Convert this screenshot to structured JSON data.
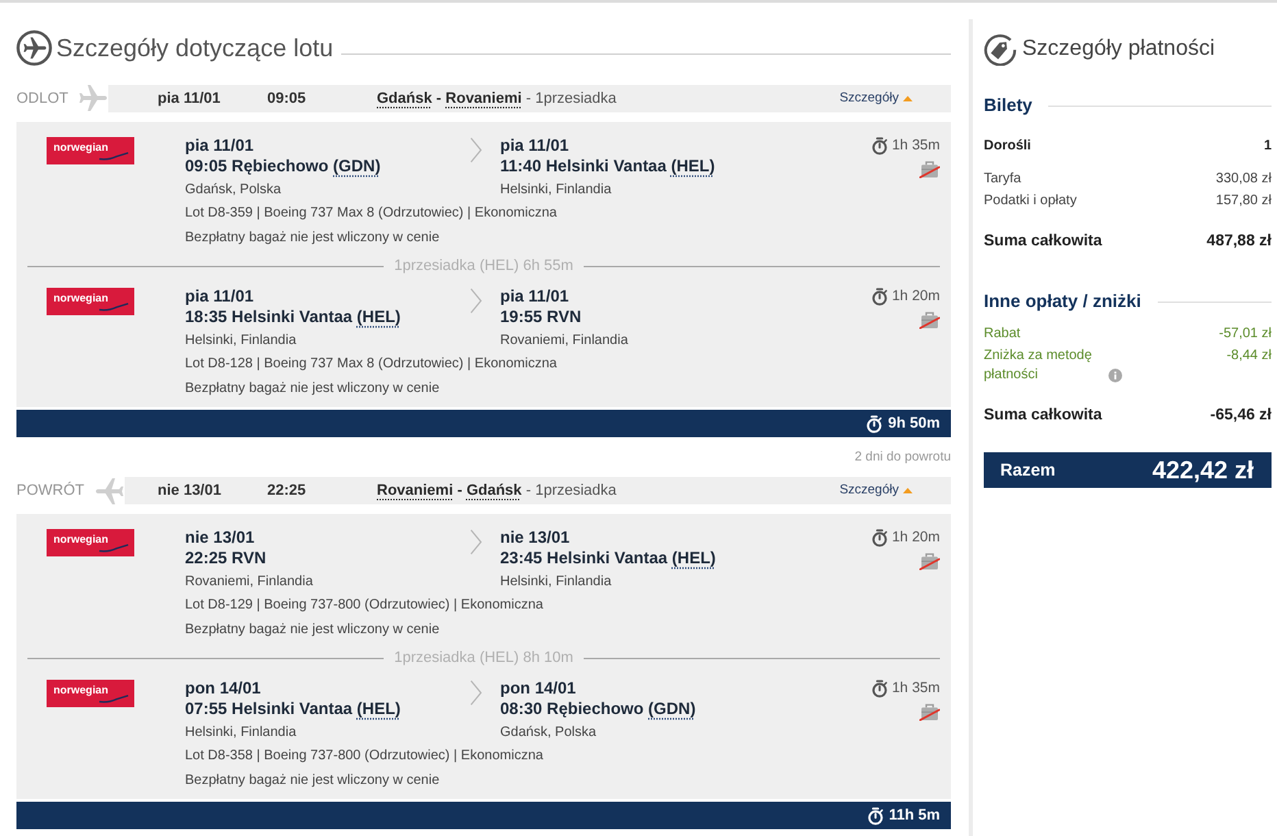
{
  "flight_section": {
    "title": "Szczegóły dotyczące lotu"
  },
  "legs": [
    {
      "label": "ODLOT",
      "kind": "outbound",
      "date": "pia 11/01",
      "time": "09:05",
      "from": "Gdańsk",
      "separator": "-",
      "to": "Rovaniemi",
      "stops": "1przesiadka",
      "details_link": "Szczegóły",
      "expanded": true,
      "rows": [
        {
          "kind": "segment",
          "airline_logo": "norwegian",
          "departure": {
            "date": "pia 11/01",
            "place": "09:05 Rębiechowo",
            "code": "(GDN)",
            "city": "Gdańsk, Polska"
          },
          "arrival": {
            "date": "pia 11/01",
            "place": "11:40 Helsinki Vantaa",
            "code": "(HEL)",
            "city": "Helsinki, Finlandia"
          },
          "duration": "1h 35m",
          "flight_info": "Lot D8-359 | Boeing 737 Max 8 (Odrzutowiec) | Ekonomiczna",
          "baggage_note": "Bezpłatny bagaż nie jest wliczony w cenie",
          "baggage_included": false
        },
        {
          "kind": "layover",
          "text": "1przesiadka (HEL) 6h 55m"
        },
        {
          "kind": "segment",
          "airline_logo": "norwegian",
          "departure": {
            "date": "pia 11/01",
            "place": "18:35 Helsinki Vantaa",
            "code": "(HEL)",
            "city": "Helsinki, Finlandia"
          },
          "arrival": {
            "date": "pia 11/01",
            "place": "19:55 RVN",
            "city": "Rovaniemi, Finlandia"
          },
          "duration": "1h 20m",
          "flight_info": "Lot D8-128 | Boeing 737 Max 8 (Odrzutowiec) | Ekonomiczna",
          "baggage_note": "Bezpłatny bagaż nie jest wliczony w cenie",
          "baggage_included": false
        }
      ],
      "total_duration": "9h 50m"
    },
    {
      "days_between": "2 dni do powrotu",
      "label": "POWRÓT",
      "kind": "return",
      "date": "nie 13/01",
      "time": "22:25",
      "from": "Rovaniemi",
      "separator": "-",
      "to": "Gdańsk",
      "stops": "1przesiadka",
      "details_link": "Szczegóły",
      "expanded": true,
      "rows": [
        {
          "kind": "segment",
          "airline_logo": "norwegian",
          "departure": {
            "date": "nie 13/01",
            "place": "22:25 RVN",
            "city": "Rovaniemi, Finlandia"
          },
          "arrival": {
            "date": "nie 13/01",
            "place": "23:45 Helsinki Vantaa",
            "code": "(HEL)",
            "city": "Helsinki, Finlandia"
          },
          "duration": "1h 20m",
          "flight_info": "Lot D8-129 | Boeing 737-800 (Odrzutowiec) | Ekonomiczna",
          "baggage_note": "Bezpłatny bagaż nie jest wliczony w cenie",
          "baggage_included": false
        },
        {
          "kind": "layover",
          "text": "1przesiadka (HEL) 8h 10m"
        },
        {
          "kind": "segment",
          "airline_logo": "norwegian",
          "departure": {
            "date": "pon 14/01",
            "place": "07:55 Helsinki Vantaa",
            "code": "(HEL)",
            "city": "Helsinki, Finlandia"
          },
          "arrival": {
            "date": "pon 14/01",
            "place": "08:30 Rębiechowo",
            "code": "(GDN)",
            "city": "Gdańsk, Polska"
          },
          "duration": "1h 35m",
          "flight_info": "Lot D8-358 | Boeing 737-800 (Odrzutowiec) | Ekonomiczna",
          "baggage_note": "Bezpłatny bagaż nie jest wliczony w cenie",
          "baggage_included": false
        }
      ],
      "total_duration": "11h 5m"
    }
  ],
  "payment": {
    "title": "Szczegóły płatności",
    "sections": [
      {
        "title": "Bilety",
        "rows": [
          {
            "kind": "count",
            "label": "Dorośli",
            "value": "1"
          },
          {
            "kind": "line",
            "label": "Taryfa",
            "value": "330,08 zł"
          },
          {
            "kind": "line",
            "label": "Podatki i opłaty",
            "value": "157,80 zł"
          },
          {
            "kind": "total",
            "label": "Suma całkowita",
            "value": "487,88 zł"
          }
        ]
      },
      {
        "title": "Inne opłaty / zniżki",
        "rows": [
          {
            "kind": "discount",
            "label": "Rabat",
            "value": "-57,01 zł"
          },
          {
            "kind": "discount",
            "label": "Zniżka za metodę płatności",
            "value": "-8,44 zł",
            "info": true
          },
          {
            "kind": "total",
            "label": "Suma całkowita",
            "value": "-65,46 zł"
          }
        ]
      }
    ],
    "grand_total": {
      "label": "Razem",
      "value": "422,42 zł"
    }
  }
}
